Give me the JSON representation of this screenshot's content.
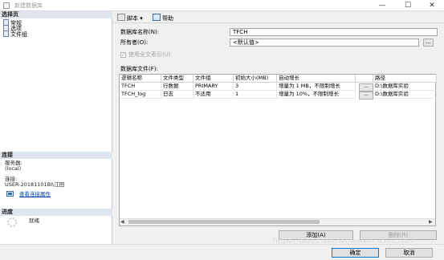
{
  "window": {
    "title": "新建数据库",
    "minimize": "—",
    "maximize": "☐",
    "close": "✕"
  },
  "left_panel": {
    "select_page_header": "选择页",
    "pages": [
      "常规",
      "选项",
      "文件组"
    ],
    "connection_header": "连接",
    "server_label": "服务器:",
    "server_value": "(local)",
    "connection_label": "连接:",
    "connection_value": "USER-20181101BI\\江田",
    "view_connection_props": "查看连接属性",
    "progress_header": "进度",
    "progress_status": "就绪"
  },
  "toolbar": {
    "script_label": "脚本",
    "help_label": "帮助"
  },
  "form": {
    "db_name_label": "数据库名称(N):",
    "db_name_value": "TFCH",
    "owner_label": "所有者(O):",
    "owner_value": "<默认值>",
    "fulltext_label": "使用全文索引(U)",
    "fulltext_checked": true,
    "db_files_label": "数据库文件(F):"
  },
  "grid": {
    "columns": [
      "逻辑名称",
      "文件类型",
      "文件组",
      "初始大小(MB)",
      "自动增长",
      "",
      "路径"
    ],
    "rows": [
      [
        "TFCH",
        "行数据",
        "PRIMARY",
        "3",
        "增量为 1 MB，不限制增长",
        "...",
        "D:\\数据库实验"
      ],
      [
        "TFCH_log",
        "日志",
        "不适用",
        "1",
        "增量为 10%，不限制增长",
        "...",
        "D:\\数据库实验"
      ]
    ]
  },
  "buttons": {
    "add": "添加(A)",
    "delete": "删除(R)",
    "ok": "确定",
    "cancel": "取消"
  },
  "watermark": "https://blog.csdn.net/weixin_45705067"
}
